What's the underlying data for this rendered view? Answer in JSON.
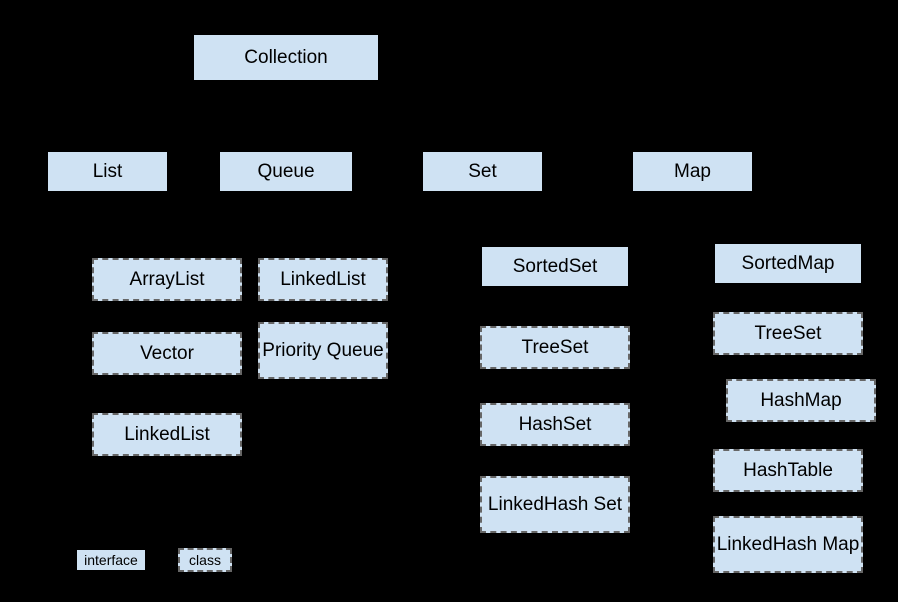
{
  "root": {
    "label": "Collection"
  },
  "interfaces": {
    "list": "List",
    "queue": "Queue",
    "set": "Set",
    "map": "Map",
    "sortedset": "SortedSet",
    "sortedmap": "SortedMap"
  },
  "classes": {
    "arraylist": "ArrayList",
    "vector": "Vector",
    "linkedlist_list": "LinkedList",
    "linkedlist_queue": "LinkedList",
    "priorityqueue": "Priority Queue",
    "treeset_set": "TreeSet",
    "hashset": "HashSet",
    "linkedhashset": "LinkedHash Set",
    "treeset_map": "TreeSet",
    "hashmap": "HashMap",
    "hashtable": "HashTable",
    "linkedhashmap": "LinkedHash Map"
  },
  "legend": {
    "interface": "interface",
    "class": "class"
  }
}
